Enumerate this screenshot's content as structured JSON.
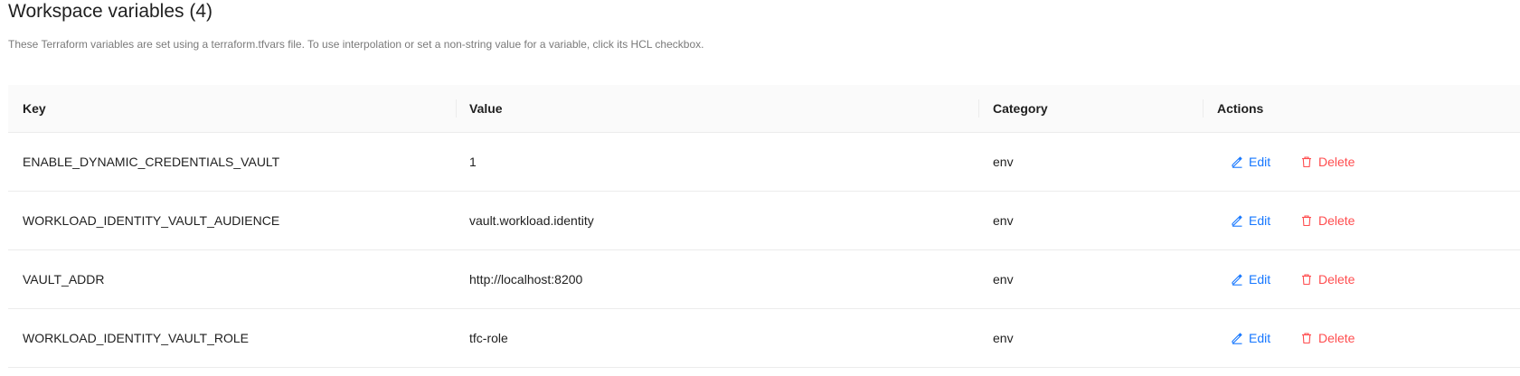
{
  "header": {
    "title": "Workspace variables (4)",
    "description": "These Terraform variables are set using a terraform.tfvars file. To use interpolation or set a non-string value for a variable, click its HCL checkbox."
  },
  "table": {
    "columns": {
      "key": "Key",
      "value": "Value",
      "category": "Category",
      "actions": "Actions"
    },
    "rows": [
      {
        "key": "ENABLE_DYNAMIC_CREDENTIALS_VAULT",
        "value": "1",
        "category": "env"
      },
      {
        "key": "WORKLOAD_IDENTITY_VAULT_AUDIENCE",
        "value": "vault.workload.identity",
        "category": "env"
      },
      {
        "key": "VAULT_ADDR",
        "value": "http://localhost:8200",
        "category": "env"
      },
      {
        "key": "WORKLOAD_IDENTITY_VAULT_ROLE",
        "value": "tfc-role",
        "category": "env"
      }
    ],
    "action_labels": {
      "edit": "Edit",
      "delete": "Delete"
    }
  },
  "icons": {
    "edit": "edit-pencil-icon",
    "delete": "trash-icon"
  },
  "colors": {
    "edit_link": "#1677ff",
    "delete_link": "#ff4d4f",
    "header_bg": "#fafafa",
    "border": "#ececec"
  }
}
